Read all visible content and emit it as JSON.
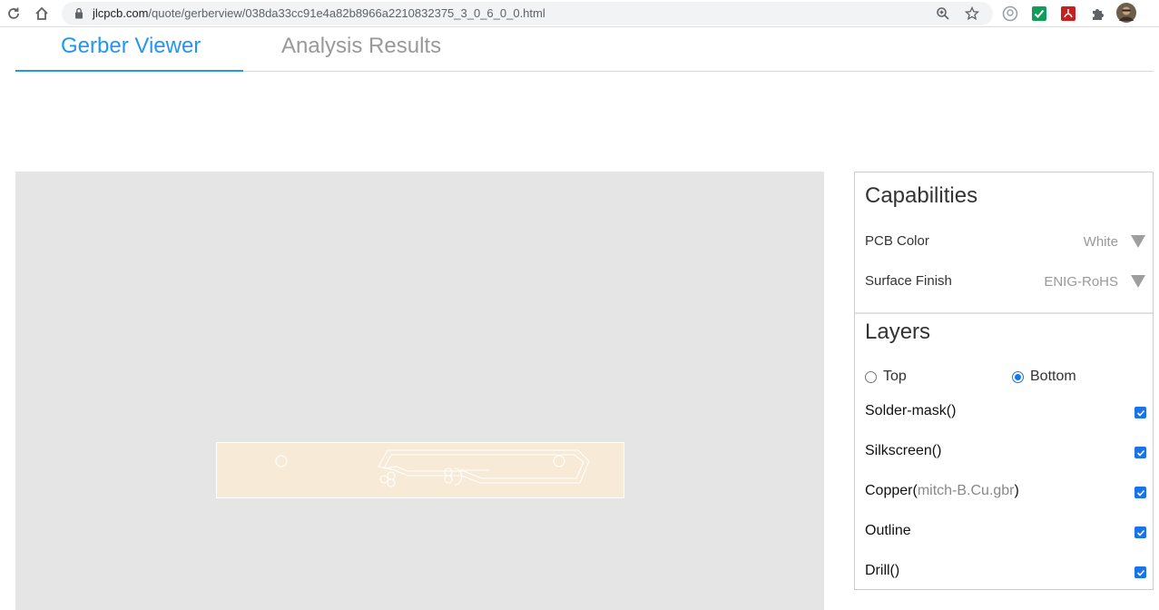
{
  "browser": {
    "url_host": "jlcpcb.com",
    "url_path": "/quote/gerberview/038da33cc91e4a82b8966a2210832375_3_0_6_0_0.html"
  },
  "tabs": [
    {
      "label": "Gerber Viewer",
      "active": true
    },
    {
      "label": "Analysis Results",
      "active": false
    }
  ],
  "capabilities": {
    "title": "Capabilities",
    "pcb_color": {
      "label": "PCB Color",
      "value": "White"
    },
    "surface_finish": {
      "label": "Surface Finish",
      "value": "ENIG-RoHS"
    }
  },
  "layers": {
    "title": "Layers",
    "side_options": [
      {
        "label": "Top",
        "selected": false
      },
      {
        "label": "Bottom",
        "selected": true
      }
    ],
    "items": [
      {
        "label": "Solder-mask()",
        "file": "",
        "checked": true
      },
      {
        "label": "Silkscreen()",
        "file": "",
        "checked": true
      },
      {
        "label": "Copper(",
        "file": "mitch-B.Cu.gbr",
        "suffix": ")",
        "checked": true
      },
      {
        "label": "Outline",
        "file": "",
        "checked": true
      },
      {
        "label": "Drill()",
        "file": "",
        "checked": true
      }
    ]
  },
  "colors": {
    "accent": "#2196f3",
    "inactive_tab": "#999999",
    "viewer_bg": "#e5e5e5",
    "pcb_fill": "#f7ead6",
    "checkbox": "#1a73e8"
  }
}
